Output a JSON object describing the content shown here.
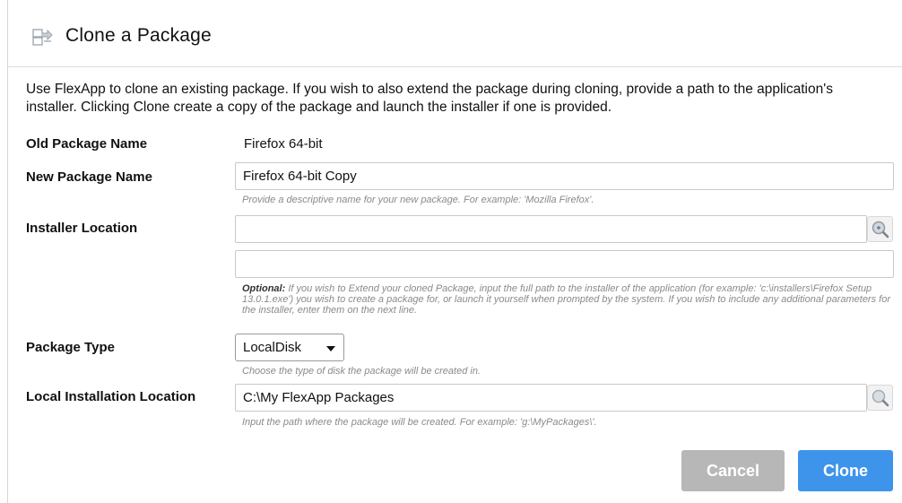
{
  "header": {
    "title": "Clone a Package",
    "icon": "package-clone-icon"
  },
  "intro": "Use FlexApp to clone an existing package. If you wish to also extend the package during cloning, provide a path to the application's installer. Clicking Clone create a copy of the package and launch the installer if one is provided.",
  "fields": {
    "old_name": {
      "label": "Old Package Name",
      "value": "Firefox 64-bit"
    },
    "new_name": {
      "label": "New Package Name",
      "value": "Firefox 64-bit Copy",
      "help": "Provide a descriptive name for your new package. For example: 'Mozilla Firefox'."
    },
    "installer": {
      "label": "Installer Location",
      "value": "",
      "params_value": "",
      "help_prefix": "Optional:",
      "help": " If you wish to Extend your cloned Package, input the full path to the installer of the application (for example: 'c:\\installers\\Firefox Setup 13.0.1.exe') you wish to create a package for, or launch it yourself when prompted by the system. If you wish to include any additional parameters for the installer, enter them on the next line."
    },
    "package_type": {
      "label": "Package Type",
      "selected": "LocalDisk",
      "help": "Choose the type of disk the package will be created in."
    },
    "local_location": {
      "label": "Local Installation Location",
      "value": "C:\\My FlexApp Packages",
      "help": "Input the path where the package will be created. For example: 'g:\\MyPackages\\'."
    }
  },
  "buttons": {
    "cancel": "Cancel",
    "clone": "Clone"
  },
  "colors": {
    "clone_button": "#3d94ea",
    "cancel_button": "#b7b7b7"
  }
}
